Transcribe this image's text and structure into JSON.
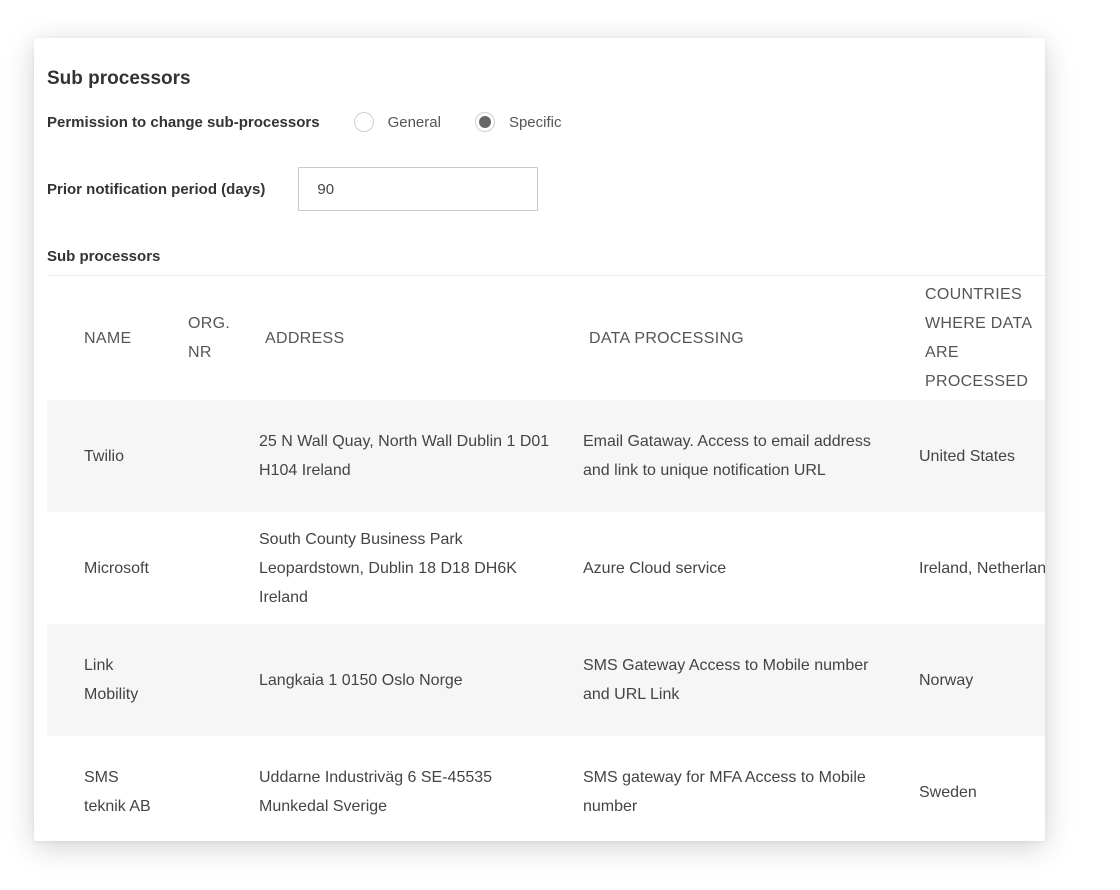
{
  "section_title": "Sub processors",
  "permission": {
    "label": "Permission to change sub-processors",
    "options": [
      {
        "label": "General",
        "selected": false
      },
      {
        "label": "Specific",
        "selected": true
      }
    ]
  },
  "notification": {
    "label": "Prior notification period (days)",
    "value": "90"
  },
  "table": {
    "label": "Sub processors",
    "headers": {
      "name": "NAME",
      "org": "ORG. NR",
      "address": "ADDRESS",
      "data_processing": "DATA PROCESSING",
      "countries": "COUNTRIES WHERE DATA ARE PROCESSED"
    },
    "rows": [
      {
        "name": "Twilio",
        "org": "",
        "address": "25 N Wall Quay, North Wall Dublin 1 D01 H104 Ireland",
        "data_processing": "Email Gataway. Access to email address and link to unique notification URL",
        "countries": "United States"
      },
      {
        "name": "Microsoft",
        "org": "",
        "address": "South County Business Park Leopardstown, Dublin 18 D18 DH6K Ireland",
        "data_processing": "Azure Cloud service",
        "countries": "Ireland, Netherlands"
      },
      {
        "name": "Link Mobility",
        "org": "",
        "address": "Langkaia 1 0150 Oslo Norge",
        "data_processing": "SMS Gateway Access to Mobile number and URL Link",
        "countries": "Norway"
      },
      {
        "name": "SMS teknik AB",
        "org": "",
        "address": "Uddarne Industriväg 6 SE-45535 Munkedal Sverige",
        "data_processing": "SMS gateway for MFA Access to Mobile number",
        "countries": "Sweden"
      }
    ]
  }
}
